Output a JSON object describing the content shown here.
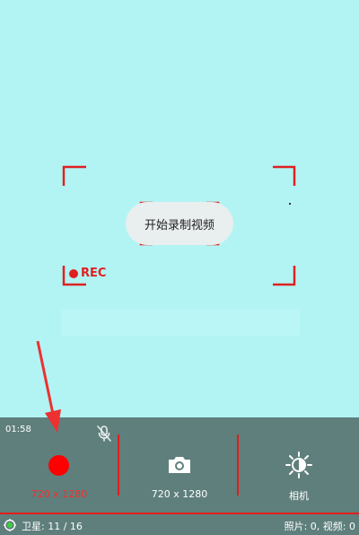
{
  "toast": {
    "text": "开始录制视频"
  },
  "rec_label": "REC",
  "recording": {
    "timer": "01:58"
  },
  "modes": [
    {
      "label": "720 x 1280",
      "icon": "record-dot-icon",
      "active": true
    },
    {
      "label": "720 x 1280",
      "icon": "camera-icon",
      "active": false
    },
    {
      "label": "相机",
      "icon": "brightness-icon",
      "active": false
    }
  ],
  "status": {
    "satellites": "卫星: 11 / 16",
    "counts": "照片: 0, 视频: 0"
  },
  "colors": {
    "viewfinder_bg": "#b2f4f4",
    "bar_bg": "#5f7f7c",
    "accent_red": "#e11d1d",
    "rec_red": "#e02020",
    "active_label": "#ff2a2a"
  },
  "mic": {
    "icon": "mic-off-icon"
  }
}
